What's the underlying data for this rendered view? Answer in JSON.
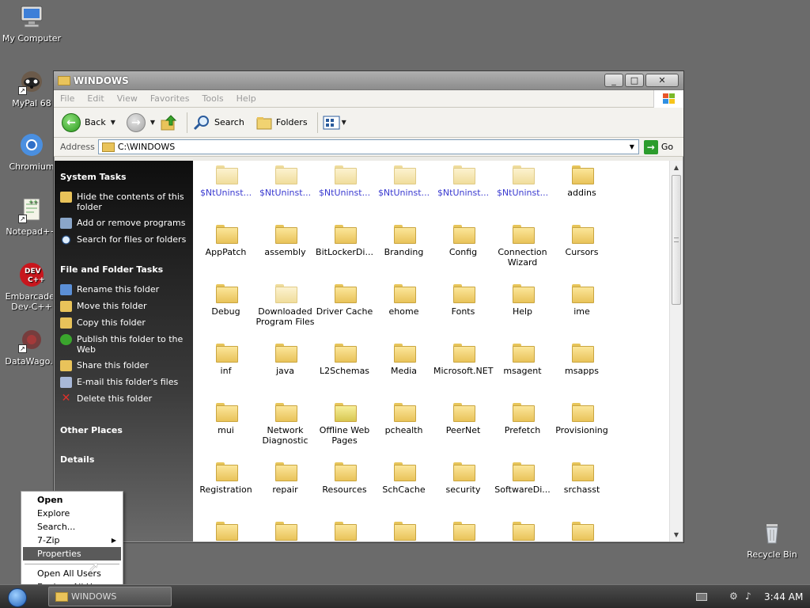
{
  "desktop": {
    "icons": [
      {
        "label": "My Computer",
        "icon": "computer-icon"
      },
      {
        "label": "MyPal 68",
        "icon": "raccoon-browser-icon"
      },
      {
        "label": "Chromium",
        "icon": "chromium-icon"
      },
      {
        "label": "Notepad++",
        "icon": "notepad-plus-plus-icon"
      },
      {
        "label": "Embarcader Dev-C++",
        "icon": "dev-cpp-icon"
      },
      {
        "label": "DataWago...",
        "icon": "datawagon-icon"
      },
      {
        "label": "Recycle Bin",
        "icon": "recycle-bin-icon"
      }
    ]
  },
  "window": {
    "title": "WINDOWS",
    "buttons": {
      "minimize": "_",
      "maximize": "□",
      "close": "✕"
    },
    "menu": [
      "File",
      "Edit",
      "View",
      "Favorites",
      "Tools",
      "Help"
    ],
    "toolbar": {
      "back_label": "Back",
      "search_label": "Search",
      "folders_label": "Folders"
    },
    "address": {
      "label": "Address",
      "value": "C:\\WINDOWS",
      "go_label": "Go"
    }
  },
  "taskpane": {
    "system_tasks": {
      "title": "System Tasks",
      "items": [
        "Hide the contents of this folder",
        "Add or remove programs",
        "Search for files or folders"
      ]
    },
    "file_folder_tasks": {
      "title": "File and Folder Tasks",
      "items": [
        "Rename this folder",
        "Move this folder",
        "Copy this folder",
        "Publish this folder to the Web",
        "Share this folder",
        "E-mail this folder's files",
        "Delete this folder"
      ]
    },
    "other_places": "Other Places",
    "details": "Details"
  },
  "files": [
    [
      "$NtUninst...",
      "$NtUninst...",
      "$NtUninst...",
      "$NtUninst...",
      "$NtUninst...",
      "$NtUninst...",
      "addins"
    ],
    [
      "AppPatch",
      "assembly",
      "BitLockerDi...",
      "Branding",
      "Config",
      "Connection Wizard",
      "Cursors"
    ],
    [
      "Debug",
      "Downloaded Program Files",
      "Driver Cache",
      "ehome",
      "Fonts",
      "Help",
      "ime"
    ],
    [
      "inf",
      "java",
      "L2Schemas",
      "Media",
      "Microsoft.NET",
      "msagent",
      "msapps"
    ],
    [
      "mui",
      "Network Diagnostic",
      "Offline Web Pages",
      "pchealth",
      "PeerNet",
      "Prefetch",
      "Provisioning"
    ],
    [
      "Registration",
      "repair",
      "Resources",
      "SchCache",
      "security",
      "SoftwareDi...",
      "srchasst"
    ]
  ],
  "context_menu": {
    "items": [
      "Open",
      "Explore",
      "Search...",
      "7-Zip",
      "Properties"
    ],
    "items2": [
      "Open All Users",
      "Explore All Users"
    ],
    "highlighted": "Properties"
  },
  "taskbar": {
    "task_label": "WINDOWS",
    "clock": "3:44 AM"
  }
}
